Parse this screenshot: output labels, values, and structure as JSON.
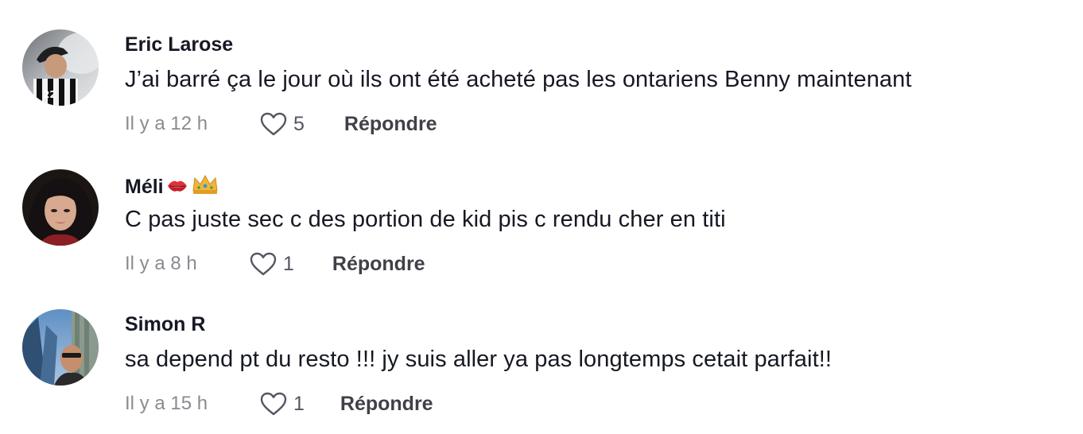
{
  "comments": [
    {
      "username": "Eric Larose",
      "text": "J’ai barré ça le jour où ils ont été acheté pas les ontariens Benny maintenant",
      "time": "Il y a 12 h",
      "likes": "5",
      "reply_label": "Répondre",
      "avatar": "avatar-eric-larose"
    },
    {
      "username": "Méli",
      "username_emojis": [
        "kiss-mark-icon",
        "crown-icon"
      ],
      "text": "C pas juste sec c des portion de kid pis c rendu cher en titi",
      "time": "Il y a 8 h",
      "likes": "1",
      "reply_label": "Répondre",
      "avatar": "avatar-meli"
    },
    {
      "username": "Simon R",
      "text": "sa depend pt du resto !!! jy suis aller ya pas longtemps cetait parfait!!",
      "time": "Il y a 15 h",
      "likes": "1",
      "reply_label": "Répondre",
      "avatar": "avatar-simon-r"
    }
  ],
  "colors": {
    "text": "#161823",
    "secondary": "#8a8b91",
    "reply": "#404148",
    "background": "#ffffff"
  }
}
